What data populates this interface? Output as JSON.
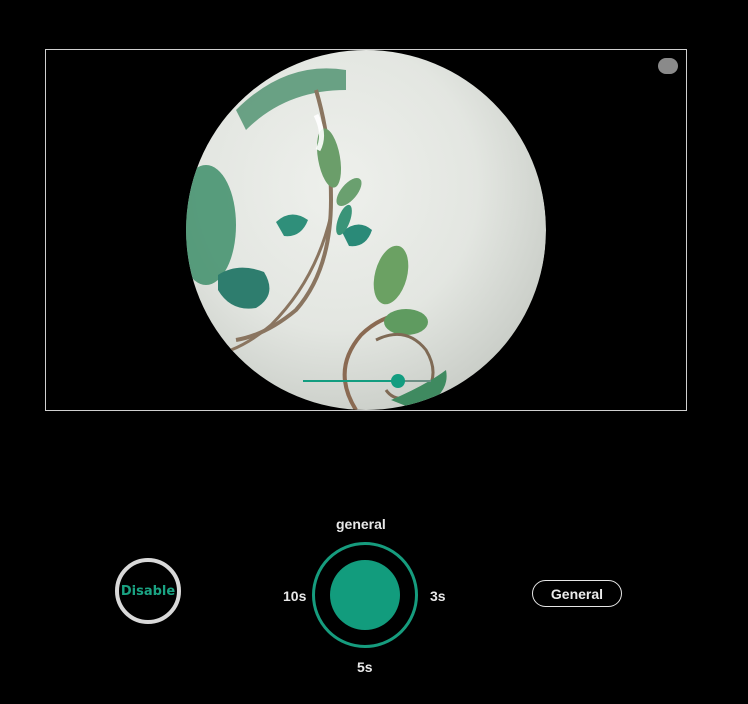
{
  "preview": {
    "image": "painted-porcelain-bowl-image",
    "toggle_icon": "toggle-dot-icon",
    "slider": {
      "value": 0.74
    }
  },
  "controls": {
    "disable_label": "Disable",
    "mode_label": "general",
    "timer_left": "10s",
    "timer_right": "3s",
    "timer_bottom": "5s",
    "general_label": "General"
  },
  "colors": {
    "background": "#000000",
    "accent": "#139d80",
    "ring": "#d9d9d9"
  }
}
